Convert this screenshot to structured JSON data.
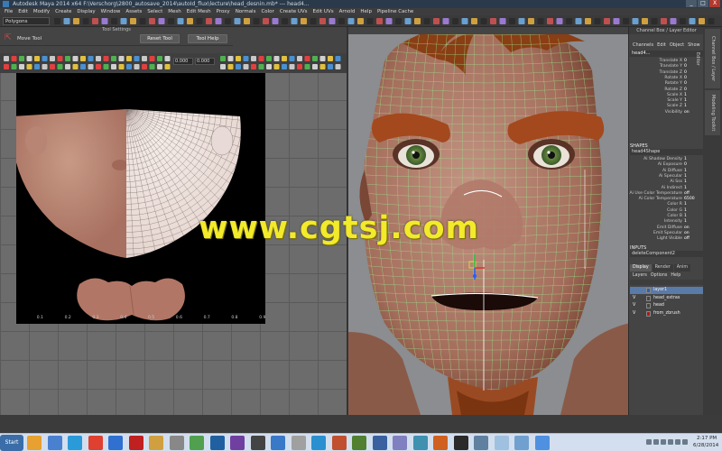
{
  "window": {
    "title": "Autodesk Maya 2014 x64 F:\\Verschorg\\2800_autosave_2014\\autoId_flux\\lecture\\head_desnin.mb*    ---    head4...",
    "buttons": [
      "_",
      "□",
      "X"
    ]
  },
  "menubar": [
    "File",
    "Edit",
    "Modify",
    "Create",
    "Display",
    "Window",
    "Assets",
    "Select",
    "Mesh",
    "Edit Mesh",
    "Proxy",
    "Normals",
    "Color",
    "Create UVs",
    "Edit UVs",
    "Arnold",
    "Help",
    "Pipeline Cache"
  ],
  "status_line": {
    "mode": "Polygons"
  },
  "tool_settings": {
    "title": "Tool Settings",
    "tool_name": "Move Tool",
    "reset_label": "Reset Tool",
    "help_label": "Tool Help"
  },
  "uv_editor": {
    "fields": [
      "0.000",
      "0.000"
    ],
    "ruler": [
      "0.1",
      "0.2",
      "0.3",
      "0.4",
      "0.5",
      "0.6",
      "0.7",
      "0.8",
      "0.9"
    ]
  },
  "channel_box": {
    "header": "Channel Box / Layer Editor",
    "menu": [
      "Channels",
      "Edit",
      "Object",
      "Show"
    ],
    "node": "head4...",
    "attributes": [
      {
        "name": "Translate X",
        "value": "0"
      },
      {
        "name": "Translate Y",
        "value": "0"
      },
      {
        "name": "Translate Z",
        "value": "0"
      },
      {
        "name": "Rotate X",
        "value": "0"
      },
      {
        "name": "Rotate Y",
        "value": "0"
      },
      {
        "name": "Rotate Z",
        "value": "0"
      },
      {
        "name": "Scale X",
        "value": "1"
      },
      {
        "name": "Scale Y",
        "value": "1"
      },
      {
        "name": "Scale Z",
        "value": "1"
      },
      {
        "name": "Visibility",
        "value": "on"
      }
    ],
    "shapes_label": "SHAPES",
    "shape_node": "head4Shape",
    "shape_attributes": [
      {
        "name": "Ai Shadow Density",
        "value": "1"
      },
      {
        "name": "Ai Exposure",
        "value": "0"
      },
      {
        "name": "Ai Diffuse",
        "value": "1"
      },
      {
        "name": "Ai Specular",
        "value": "1"
      },
      {
        "name": "Ai Sss",
        "value": "1"
      },
      {
        "name": "Ai Indirect",
        "value": "1"
      },
      {
        "name": "Ai Use Color Temperature",
        "value": "off"
      },
      {
        "name": "Ai Color Temperature",
        "value": "6500"
      },
      {
        "name": "Color R",
        "value": "1"
      },
      {
        "name": "Color G",
        "value": "1"
      },
      {
        "name": "Color B",
        "value": "1"
      },
      {
        "name": "Intensity",
        "value": "1"
      },
      {
        "name": "Emit Diffuse",
        "value": "on"
      },
      {
        "name": "Emit Specular",
        "value": "on"
      },
      {
        "name": "Light Visible",
        "value": "off"
      }
    ],
    "inputs_label": "INPUTS",
    "input_node": "deleteComponent2"
  },
  "layer_editor": {
    "tabs": [
      "Display",
      "Render",
      "Anim"
    ],
    "menu": [
      "Layers",
      "Options",
      "Help"
    ],
    "layers": [
      {
        "vis": "",
        "name": "layer1",
        "color": "#2a5fb0"
      },
      {
        "vis": "V",
        "name": "head_extras",
        "color": "#444444"
      },
      {
        "vis": "V",
        "name": "head",
        "color": "#444444"
      },
      {
        "vis": "V",
        "name": "from_zbrush",
        "color": "#b01818"
      }
    ]
  },
  "side_tabs": [
    "Channel Box / Layer Editor",
    "Modeling Toolkit"
  ],
  "watermark": "www.cgtsj.com",
  "taskbar": {
    "start": "Start",
    "time": "2:17 PM",
    "date": "6/28/2014"
  },
  "colors": {
    "accent": "#3a7ab0",
    "wire": "#9adf8a",
    "skin": "#b5806a",
    "watermark": "#f2ea2a"
  }
}
